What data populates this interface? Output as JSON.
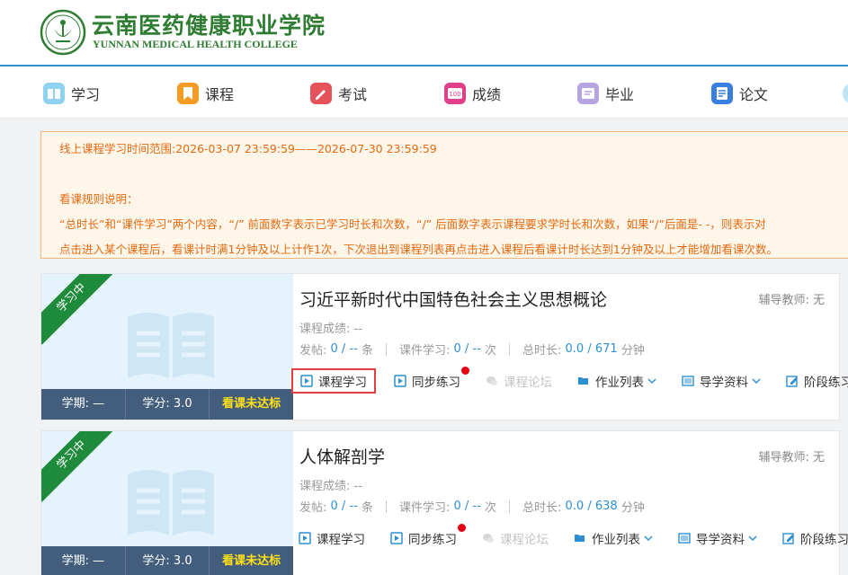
{
  "header": {
    "school_name_cn": "云南医药健康职业学院",
    "school_name_en": "YUNNAN MEDICAL HEALTH COLLEGE"
  },
  "nav": {
    "items": [
      {
        "label": "学习",
        "icon": "study-icon",
        "color": "#6fc3e8"
      },
      {
        "label": "课程",
        "icon": "course-icon",
        "color": "#f59a23"
      },
      {
        "label": "考试",
        "icon": "exam-icon",
        "color": "#e5525a"
      },
      {
        "label": "成绩",
        "icon": "grade-icon",
        "color": "#e0408a"
      },
      {
        "label": "毕业",
        "icon": "graduation-icon",
        "color": "#a993d8"
      },
      {
        "label": "论文",
        "icon": "thesis-icon",
        "color": "#3a7ee0"
      }
    ]
  },
  "notice": {
    "period": "线上课程学习时间范围:2026-03-07 23:59:59——2026-07-30 23:59:59",
    "rules_title": "看课规则说明：",
    "rule1": "“总时长”和“课件学习”两个内容，“/” 前面数字表示已学习时长和次数，“/” 后面数字表示课程要求学时长和次数，如果“/”后面是- -，则表示对",
    "rule2": "点击进入某个课程后，看课计时满1分钟及以上计作1次，下次退出到课程列表再点击进入课程后看课计时长达到1分钟及以上才能增加看课次数。"
  },
  "courses": [
    {
      "status": "学习中",
      "term": "学期: —",
      "credit": "学分: 3.0",
      "video_status": "看课未达标",
      "title": "习近平新时代中国特色社会主义思想概论",
      "tutor": "辅导教师: 无",
      "score": "课程成绩: --",
      "posts_label": "发帖:",
      "posts_value": "0 / --",
      "posts_unit": "条",
      "courseware_label": "课件学习:",
      "courseware_value": "0 / --",
      "courseware_unit": "次",
      "duration_label": "总时长:",
      "duration_value": "0.0 / 671",
      "duration_unit": "分钟",
      "actions": {
        "study": "课程学习",
        "practice": "同步练习",
        "forum": "课程论坛",
        "homework": "作业列表",
        "materials": "导学资料",
        "stage": "阶段练习"
      }
    },
    {
      "status": "学习中",
      "term": "学期: —",
      "credit": "学分: 3.0",
      "video_status": "看课未达标",
      "title": "人体解剖学",
      "tutor": "辅导教师: 无",
      "score": "课程成绩: --",
      "posts_label": "发帖:",
      "posts_value": "0 / --",
      "posts_unit": "条",
      "courseware_label": "课件学习:",
      "courseware_value": "0 / --",
      "courseware_unit": "次",
      "duration_label": "总时长:",
      "duration_value": "0.0 / 638",
      "duration_unit": "分钟",
      "actions": {
        "study": "课程学习",
        "practice": "同步练习",
        "forum": "课程论坛",
        "homework": "作业列表",
        "materials": "导学资料",
        "stage": "阶段练习"
      }
    }
  ],
  "colors": {
    "accent": "#2d8fd3",
    "notice_text": "#e46a13",
    "ribbon": "#1e8a3c",
    "term_bar": "#435e7d",
    "warn": "#ffe016",
    "badge_dot": "#e60012"
  }
}
